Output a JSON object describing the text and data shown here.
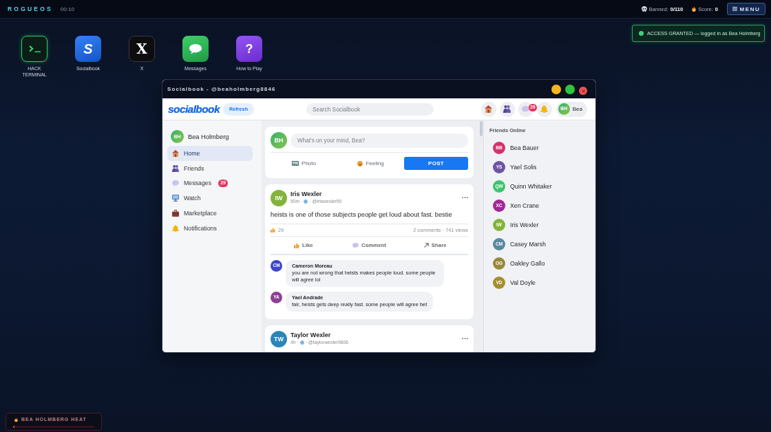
{
  "top_bar": {
    "brand": "ROGUEOS",
    "clock": "00:10",
    "banned_label": "Banned:",
    "banned_value": "0/110",
    "score_label": "Score:",
    "score_value": "0",
    "menu_button": "MENU"
  },
  "notification": {
    "text": "ACCESS GRANTED — logged in as Bea Holmberg"
  },
  "desktop_icons": [
    {
      "kind": "terminal",
      "label": "HACK TERMINAL"
    },
    {
      "kind": "socialbook",
      "glyph": "S",
      "label": "Socialbook"
    },
    {
      "kind": "x",
      "glyph": "X",
      "label": "X"
    },
    {
      "kind": "messages",
      "label": "Messages"
    },
    {
      "kind": "help",
      "glyph": "?",
      "label": "How to Play"
    }
  ],
  "window": {
    "title": "Socialbook - @beaholmberg8846"
  },
  "app": {
    "header": {
      "logo": "socialbook",
      "refresh_button": "Refresh",
      "search": {
        "placeholder": "Search Socialbook"
      },
      "nav": [
        {
          "kind": "home"
        },
        {
          "kind": "friends"
        },
        {
          "kind": "messages",
          "badge": "29"
        },
        {
          "kind": "notifications"
        }
      ],
      "profile": {
        "initials": "BH",
        "name": "Bea"
      }
    },
    "sidebar": {
      "profile": {
        "initials": "BH",
        "name": "Bea Holmberg"
      },
      "items": [
        {
          "kind": "home",
          "label": "Home",
          "selected": true
        },
        {
          "kind": "friends",
          "label": "Friends",
          "selected": false
        },
        {
          "kind": "messages",
          "label": "Messages",
          "selected": false,
          "badge": "29"
        },
        {
          "kind": "watch",
          "label": "Watch",
          "selected": false
        },
        {
          "kind": "marketplace",
          "label": "Marketplace",
          "selected": false
        },
        {
          "kind": "notifications",
          "label": "Notifications",
          "selected": false
        }
      ]
    },
    "composer": {
      "initials": "BH",
      "placeholder": "What's on your mind, Bea?",
      "actions": [
        {
          "kind": "photo",
          "label": "Photo"
        },
        {
          "kind": "feeling",
          "label": "Feeling"
        }
      ],
      "post_button": "POST"
    },
    "posts": [
      {
        "initials": "IW",
        "color": "#84b33c",
        "author": "Iris Wexler",
        "time": "50m ·",
        "handle": "· @iriswexler90",
        "text": "heists is one of those subjects people get loud about fast. bestie",
        "likes": "29",
        "stats": "2 comments · 741 views",
        "actions": [
          {
            "kind": "like",
            "label": "Like"
          },
          {
            "kind": "comment",
            "label": "Comment"
          },
          {
            "kind": "share",
            "label": "Share"
          }
        ],
        "comments": [
          {
            "initials": "CM",
            "color": "#3d47c9",
            "author": "Cameron Moreau",
            "text": "you are not wrong that heists makes people loud. some people will agree lol"
          },
          {
            "initials": "YA",
            "color": "#8d3f94",
            "author": "Yael Andrade",
            "text": "fair, heists gets deep really fast. some people will agree bet"
          }
        ]
      },
      {
        "initials": "TW",
        "color": "#2b86b8",
        "author": "Taylor Wexler",
        "time": "4h ·",
        "handle": "· @taylorwexler9806"
      }
    ],
    "friends_online": {
      "title": "Friends Online",
      "friends": [
        {
          "initials": "BB",
          "color": "#d2336a",
          "name": "Bea Bauer"
        },
        {
          "initials": "YS",
          "color": "#6e55a3",
          "name": "Yael Solis"
        },
        {
          "initials": "QW",
          "color": "#3ec46d",
          "name": "Quinn Whitaker"
        },
        {
          "initials": "XC",
          "color": "#a2289a",
          "name": "Xen Crane"
        },
        {
          "initials": "IW",
          "color": "#84b33c",
          "name": "Iris Wexler"
        },
        {
          "initials": "CM",
          "color": "#5a88a0",
          "name": "Casey Marsh"
        },
        {
          "initials": "OG",
          "color": "#99893a",
          "name": "Oakley Gallo"
        },
        {
          "initials": "VD",
          "color": "#a58f2e",
          "name": "Val Doyle"
        }
      ]
    }
  },
  "heat": {
    "label": "BEA HOLMBERG HEAT",
    "level": 0
  }
}
